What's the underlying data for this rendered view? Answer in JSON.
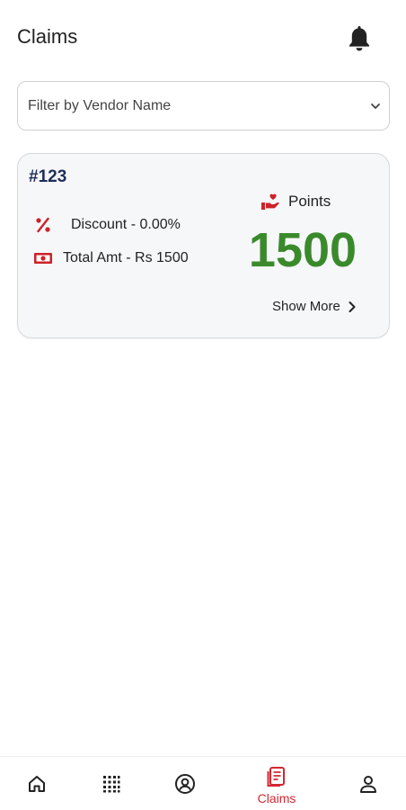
{
  "header": {
    "title": "Claims",
    "notification_icon": "bell-icon"
  },
  "filter": {
    "placeholder": "Filter by Vendor Name",
    "chevron_icon": "chevron-down-icon"
  },
  "claims": [
    {
      "id": "#123",
      "discount_text": "Discount - 0.00%",
      "total_text": "Total Amt - Rs 1500",
      "points_label": "Points",
      "points_value": "1500",
      "show_more_label": "Show More"
    }
  ],
  "bottom_nav": {
    "items": [
      {
        "icon": "home-icon",
        "label": ""
      },
      {
        "icon": "grid-icon",
        "label": ""
      },
      {
        "icon": "user-circle-icon",
        "label": ""
      },
      {
        "icon": "claims-icon",
        "label": "Claims",
        "active": true
      },
      {
        "icon": "profile-icon",
        "label": ""
      }
    ]
  },
  "colors": {
    "accent_red": "#cc2229",
    "points_green": "#3a8a2c",
    "claim_id_navy": "#1f2d5a",
    "card_bg": "#f6f7f9"
  }
}
